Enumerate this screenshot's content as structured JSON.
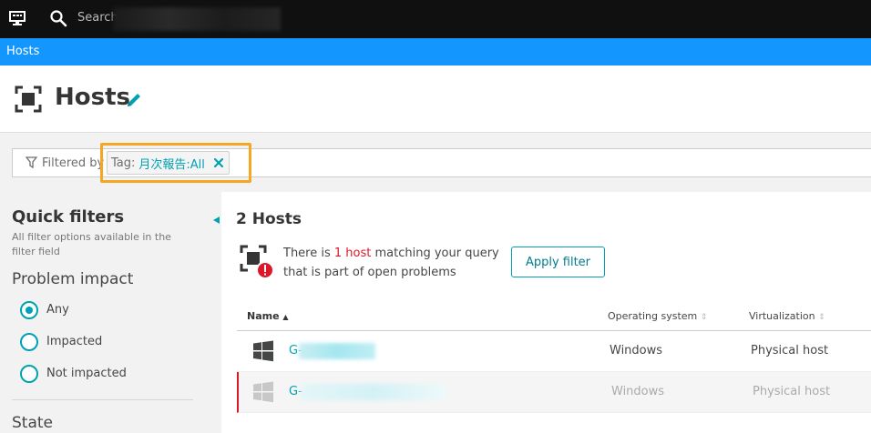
{
  "topbar": {
    "search_placeholder": "Search"
  },
  "breadcrumb": {
    "label": "Hosts"
  },
  "page": {
    "title": "Hosts"
  },
  "filter": {
    "label": "Filtered by",
    "tag_key": "Tag:",
    "tag_value": "月次報告:All"
  },
  "quick_filters": {
    "title": "Quick filters",
    "subtitle": "All filter options available in the filter field",
    "problem_impact": {
      "title": "Problem impact",
      "options": [
        "Any",
        "Impacted",
        "Not impacted"
      ],
      "selected": "Any"
    },
    "state_title": "State"
  },
  "results": {
    "title": "2 Hosts",
    "message_pre": "There is ",
    "message_highlight": "1 host",
    "message_post": " matching your query",
    "message_line2": "that is part of open problems",
    "apply_button": "Apply filter"
  },
  "table": {
    "columns": {
      "name": "Name",
      "os": "Operating system",
      "virt": "Virtualization"
    },
    "rows": [
      {
        "name": "G-",
        "os": "Windows",
        "virtualization": "Physical host",
        "problem": false
      },
      {
        "name": "G-",
        "os": "Windows",
        "virtualization": "Physical host",
        "problem": true
      }
    ]
  },
  "colors": {
    "accent": "#00a1b2",
    "brand_blue": "#1496ff",
    "problem_red": "#dc172a",
    "highlight": "#f5a623"
  }
}
